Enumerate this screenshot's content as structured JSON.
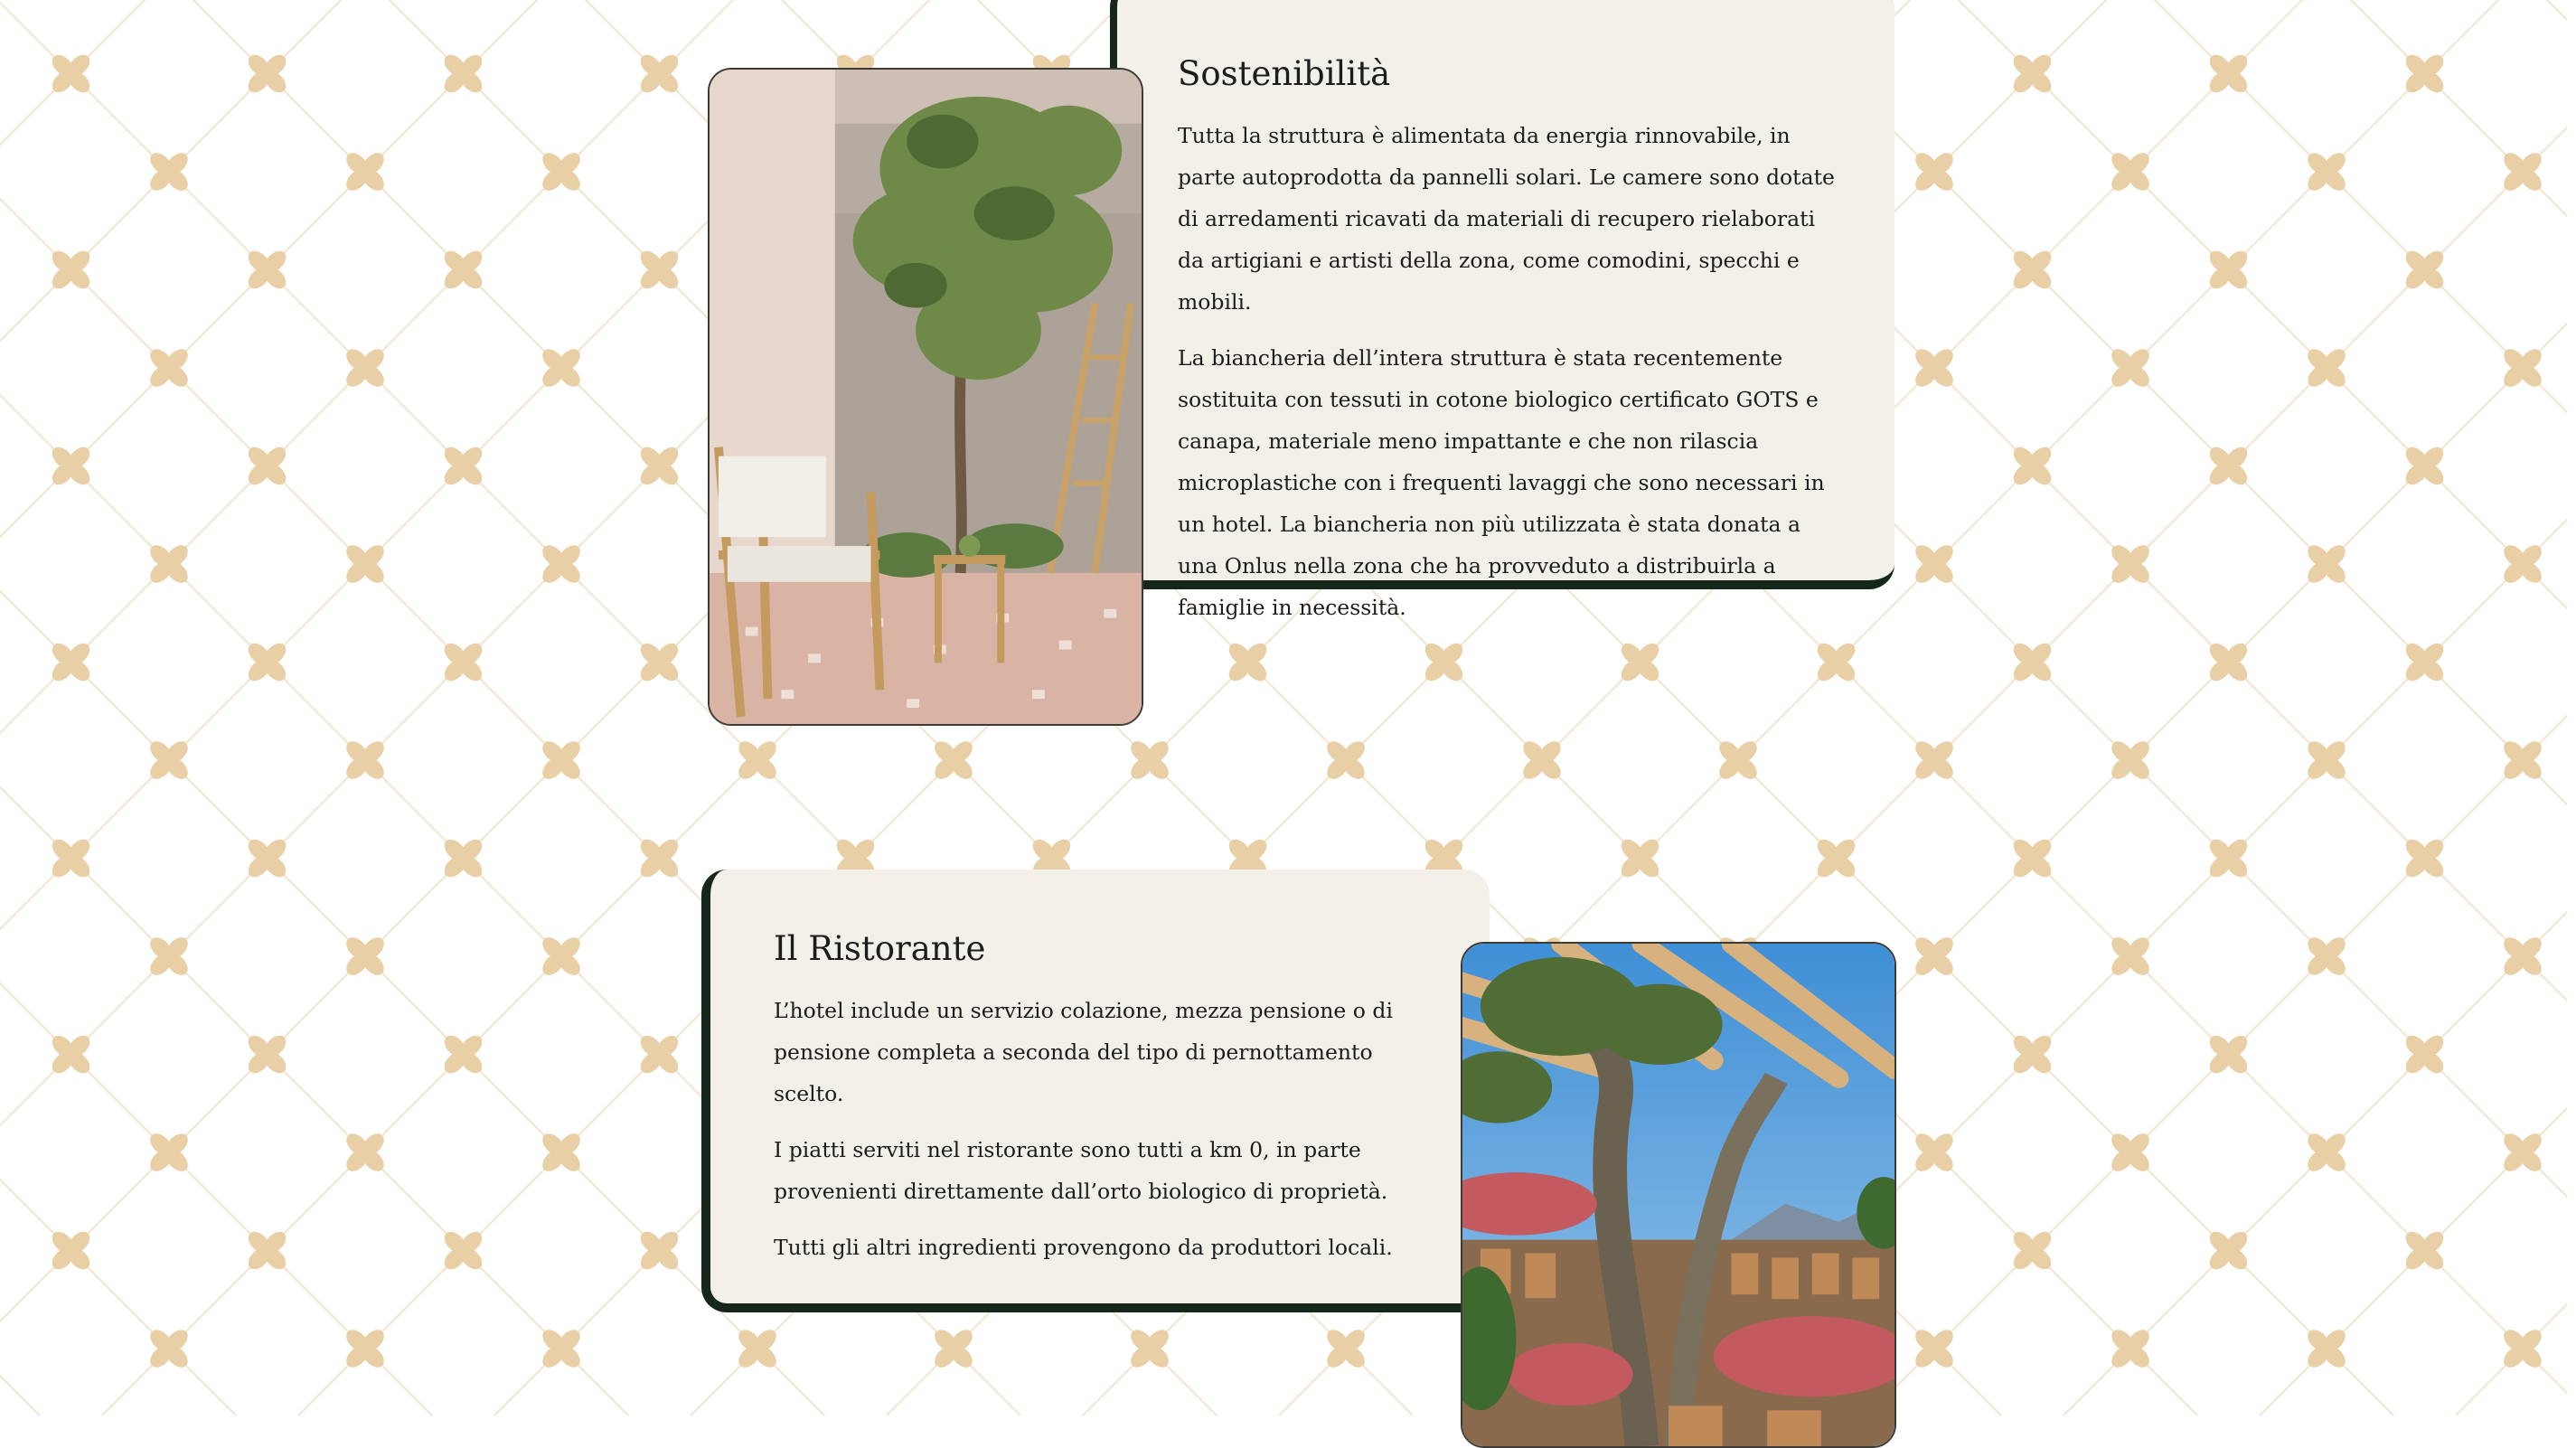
{
  "sections": [
    {
      "title": "Sostenibilità",
      "paragraphs": [
        "Tutta la struttura è alimentata da energia rinnovabile, in parte autoprodotta da pannelli solari. Le camere sono dotate di arredamenti ricavati da materiali di recupero rielaborati da artigiani e artisti della zona, come comodini, specchi e mobili.",
        "La biancheria dell’intera struttura è stata recentemente sostituita con tessuti in cotone biologico certificato GOTS e canapa, materiale meno impattante e che non rilascia microplastiche con i frequenti lavaggi che sono necessari in un hotel. La biancheria non più utilizzata è stata donata a una Onlus nella zona che ha provveduto a distribuirla a famiglie in necessità."
      ]
    },
    {
      "title": "Il Ristorante",
      "paragraphs": [
        "L’hotel include un servizio colazione, mezza pensione o di pensione completa a seconda del tipo di pernottamento scelto.",
        "I piatti serviti nel ristorante sono tutti a km 0, in parte provenienti direttamente dall’orto biologico di proprietà.",
        "Tutti gli altri ingredienti provengono da produttori locali."
      ]
    }
  ],
  "colors": {
    "card_background": "#f3f0ea",
    "card_accent": "#15261b",
    "pattern_motif": "#e8cfa6",
    "page_background": "#ffffff"
  },
  "icons": [
    "floral-pattern-icon"
  ]
}
